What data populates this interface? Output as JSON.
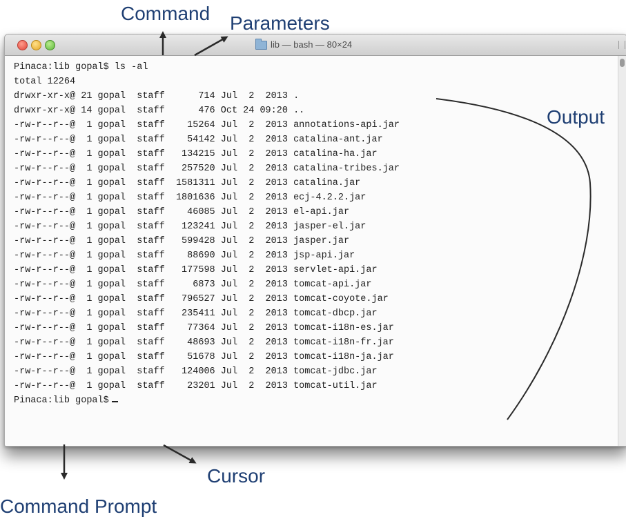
{
  "annotations": {
    "command": "Command",
    "parameters": "Parameters",
    "output": "Output",
    "cursor": "Cursor",
    "command_prompt": "Command Prompt"
  },
  "window": {
    "title": "lib — bash — 80×24",
    "icon": "folder-icon"
  },
  "terminal": {
    "command_line": "Pinaca:lib gopal$ ls -al",
    "total": "total 12264",
    "rows": [
      "drwxr-xr-x@ 21 gopal  staff      714 Jul  2  2013 .",
      "drwxr-xr-x@ 14 gopal  staff      476 Oct 24 09:20 ..",
      "-rw-r--r--@  1 gopal  staff    15264 Jul  2  2013 annotations-api.jar",
      "-rw-r--r--@  1 gopal  staff    54142 Jul  2  2013 catalina-ant.jar",
      "-rw-r--r--@  1 gopal  staff   134215 Jul  2  2013 catalina-ha.jar",
      "-rw-r--r--@  1 gopal  staff   257520 Jul  2  2013 catalina-tribes.jar",
      "-rw-r--r--@  1 gopal  staff  1581311 Jul  2  2013 catalina.jar",
      "-rw-r--r--@  1 gopal  staff  1801636 Jul  2  2013 ecj-4.2.2.jar",
      "-rw-r--r--@  1 gopal  staff    46085 Jul  2  2013 el-api.jar",
      "-rw-r--r--@  1 gopal  staff   123241 Jul  2  2013 jasper-el.jar",
      "-rw-r--r--@  1 gopal  staff   599428 Jul  2  2013 jasper.jar",
      "-rw-r--r--@  1 gopal  staff    88690 Jul  2  2013 jsp-api.jar",
      "-rw-r--r--@  1 gopal  staff   177598 Jul  2  2013 servlet-api.jar",
      "-rw-r--r--@  1 gopal  staff     6873 Jul  2  2013 tomcat-api.jar",
      "-rw-r--r--@  1 gopal  staff   796527 Jul  2  2013 tomcat-coyote.jar",
      "-rw-r--r--@  1 gopal  staff   235411 Jul  2  2013 tomcat-dbcp.jar",
      "-rw-r--r--@  1 gopal  staff    77364 Jul  2  2013 tomcat-i18n-es.jar",
      "-rw-r--r--@  1 gopal  staff    48693 Jul  2  2013 tomcat-i18n-fr.jar",
      "-rw-r--r--@  1 gopal  staff    51678 Jul  2  2013 tomcat-i18n-ja.jar",
      "-rw-r--r--@  1 gopal  staff   124006 Jul  2  2013 tomcat-jdbc.jar",
      "-rw-r--r--@  1 gopal  staff    23201 Jul  2  2013 tomcat-util.jar"
    ],
    "prompt": "Pinaca:lib gopal$"
  },
  "colors": {
    "annotation": "#1f3f73",
    "terminal_text": "#202020",
    "terminal_background": "#fbfbfb"
  }
}
